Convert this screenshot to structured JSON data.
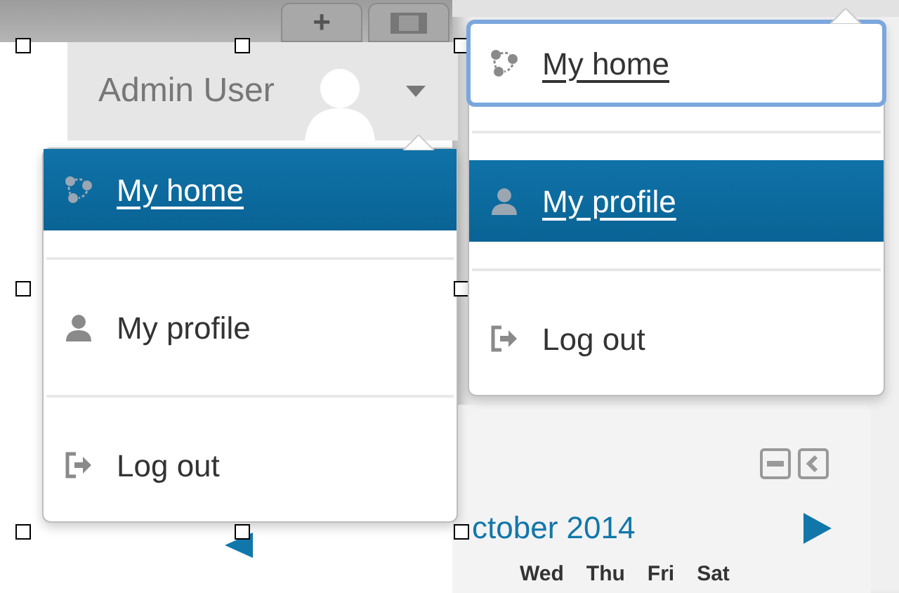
{
  "panels": [
    {
      "toolbar": {
        "add": "+"
      },
      "user": {
        "name": "Admin User"
      },
      "menu": [
        {
          "kind": "home",
          "label": "My home",
          "selected": true,
          "focused": false
        },
        {
          "kind": "profile",
          "label": "My profile",
          "selected": false,
          "focused": false
        },
        {
          "kind": "logout",
          "label": "Log out",
          "selected": false,
          "focused": false
        }
      ]
    },
    {
      "menu": [
        {
          "kind": "home",
          "label": "My home",
          "selected": false,
          "focused": true
        },
        {
          "kind": "profile",
          "label": "My profile",
          "selected": true,
          "focused": false
        },
        {
          "kind": "logout",
          "label": "Log out",
          "selected": false,
          "focused": false
        }
      ],
      "calendar": {
        "month": "ctober 2014",
        "days": [
          "Wed",
          "Thu",
          "Fri",
          "Sat"
        ]
      }
    }
  ]
}
